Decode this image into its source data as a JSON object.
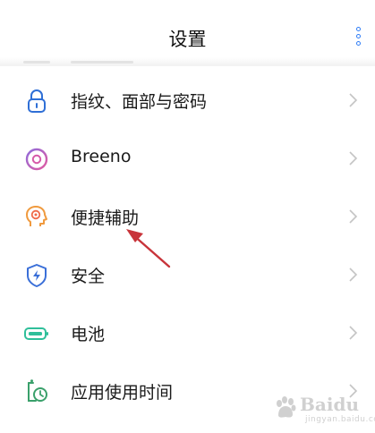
{
  "header": {
    "title": "设置"
  },
  "menu_icon": "more-vertical-icon",
  "items": [
    {
      "label": "指纹、面部与密码",
      "icon": "lock-icon",
      "color": "#2f6fd6"
    },
    {
      "label": "Breeno",
      "icon": "breeno-icon",
      "color": "#c455b8"
    },
    {
      "label": "便捷辅助",
      "icon": "assistant-head-icon",
      "color": "#f09a3e"
    },
    {
      "label": "安全",
      "icon": "shield-icon",
      "color": "#3a6fd8"
    },
    {
      "label": "电池",
      "icon": "battery-icon",
      "color": "#2fbf9a"
    },
    {
      "label": "应用使用时间",
      "icon": "app-timer-icon",
      "color": "#3aa06b"
    }
  ],
  "watermark": {
    "text": "Baidu",
    "sub": "jingyan.baidu.com"
  },
  "annotation": {
    "color": "#c8343a"
  }
}
